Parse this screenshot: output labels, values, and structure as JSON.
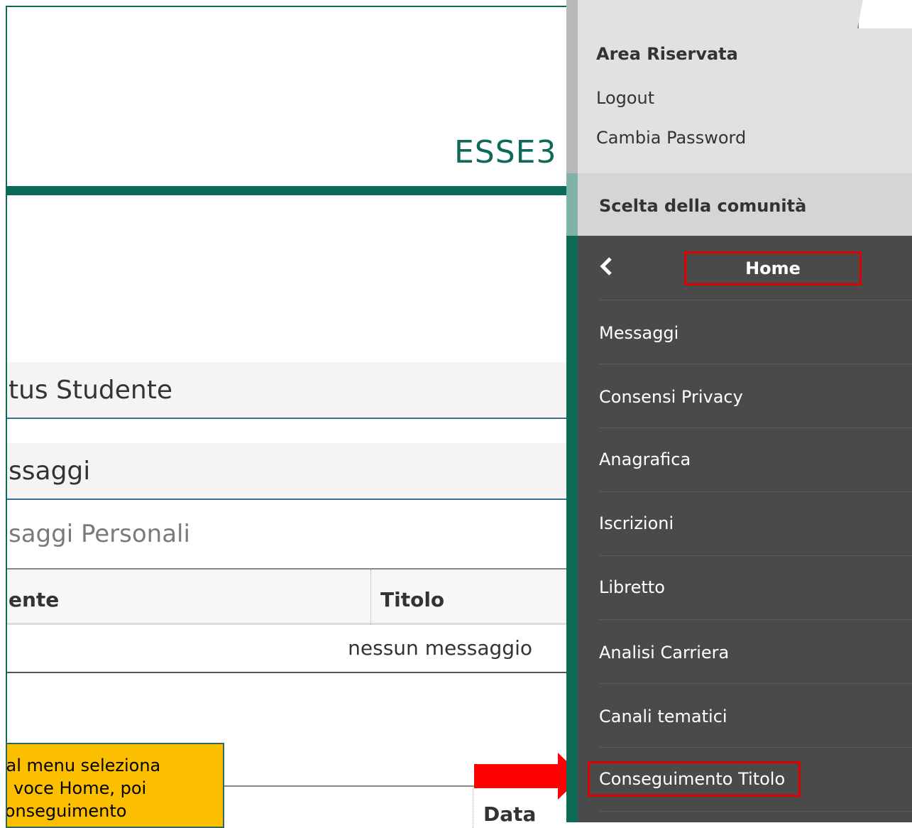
{
  "header": {
    "brand": "ESSE3"
  },
  "panels": {
    "status_title": "tus Studente",
    "messages_title": "ssaggi",
    "personal_messages_title": "saggi Personali"
  },
  "messages_table": {
    "columns": [
      "ente",
      "Titolo"
    ],
    "empty_text": "nessun messaggio"
  },
  "second_table": {
    "column_data": "Data"
  },
  "callout": {
    "lines": [
      "Dal menu seleziona",
      "la voce Home, poi",
      "Conseguimento"
    ]
  },
  "sidebar": {
    "area_title": "Area Riservata",
    "logout": "Logout",
    "change_password": "Cambia Password",
    "community_choice": "Scelta della comunità",
    "home_label": "Home",
    "items": [
      "Messaggi",
      "Consensi Privacy",
      "Anagrafica",
      "Iscrizioni",
      "Libretto",
      "Analisi Carriera",
      "Canali tematici",
      "Conseguimento Titolo"
    ]
  },
  "colors": {
    "accent": "#0e6a58",
    "sidebar_dark": "#4a4a4a",
    "highlight_red": "#e00000",
    "callout_yellow": "#fbbf00"
  }
}
